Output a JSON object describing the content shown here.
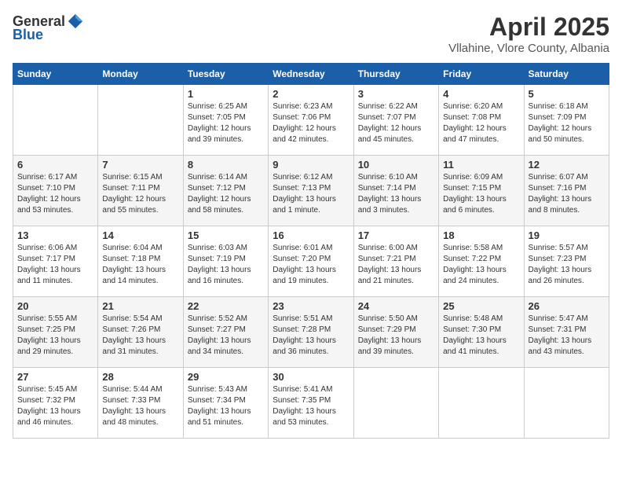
{
  "header": {
    "logo_general": "General",
    "logo_blue": "Blue",
    "month_title": "April 2025",
    "subtitle": "Vllahine, Vlore County, Albania"
  },
  "days_of_week": [
    "Sunday",
    "Monday",
    "Tuesday",
    "Wednesday",
    "Thursday",
    "Friday",
    "Saturday"
  ],
  "weeks": [
    [
      {
        "day": "",
        "sunrise": "",
        "sunset": "",
        "daylight": ""
      },
      {
        "day": "",
        "sunrise": "",
        "sunset": "",
        "daylight": ""
      },
      {
        "day": "1",
        "sunrise": "Sunrise: 6:25 AM",
        "sunset": "Sunset: 7:05 PM",
        "daylight": "Daylight: 12 hours and 39 minutes."
      },
      {
        "day": "2",
        "sunrise": "Sunrise: 6:23 AM",
        "sunset": "Sunset: 7:06 PM",
        "daylight": "Daylight: 12 hours and 42 minutes."
      },
      {
        "day": "3",
        "sunrise": "Sunrise: 6:22 AM",
        "sunset": "Sunset: 7:07 PM",
        "daylight": "Daylight: 12 hours and 45 minutes."
      },
      {
        "day": "4",
        "sunrise": "Sunrise: 6:20 AM",
        "sunset": "Sunset: 7:08 PM",
        "daylight": "Daylight: 12 hours and 47 minutes."
      },
      {
        "day": "5",
        "sunrise": "Sunrise: 6:18 AM",
        "sunset": "Sunset: 7:09 PM",
        "daylight": "Daylight: 12 hours and 50 minutes."
      }
    ],
    [
      {
        "day": "6",
        "sunrise": "Sunrise: 6:17 AM",
        "sunset": "Sunset: 7:10 PM",
        "daylight": "Daylight: 12 hours and 53 minutes."
      },
      {
        "day": "7",
        "sunrise": "Sunrise: 6:15 AM",
        "sunset": "Sunset: 7:11 PM",
        "daylight": "Daylight: 12 hours and 55 minutes."
      },
      {
        "day": "8",
        "sunrise": "Sunrise: 6:14 AM",
        "sunset": "Sunset: 7:12 PM",
        "daylight": "Daylight: 12 hours and 58 minutes."
      },
      {
        "day": "9",
        "sunrise": "Sunrise: 6:12 AM",
        "sunset": "Sunset: 7:13 PM",
        "daylight": "Daylight: 13 hours and 1 minute."
      },
      {
        "day": "10",
        "sunrise": "Sunrise: 6:10 AM",
        "sunset": "Sunset: 7:14 PM",
        "daylight": "Daylight: 13 hours and 3 minutes."
      },
      {
        "day": "11",
        "sunrise": "Sunrise: 6:09 AM",
        "sunset": "Sunset: 7:15 PM",
        "daylight": "Daylight: 13 hours and 6 minutes."
      },
      {
        "day": "12",
        "sunrise": "Sunrise: 6:07 AM",
        "sunset": "Sunset: 7:16 PM",
        "daylight": "Daylight: 13 hours and 8 minutes."
      }
    ],
    [
      {
        "day": "13",
        "sunrise": "Sunrise: 6:06 AM",
        "sunset": "Sunset: 7:17 PM",
        "daylight": "Daylight: 13 hours and 11 minutes."
      },
      {
        "day": "14",
        "sunrise": "Sunrise: 6:04 AM",
        "sunset": "Sunset: 7:18 PM",
        "daylight": "Daylight: 13 hours and 14 minutes."
      },
      {
        "day": "15",
        "sunrise": "Sunrise: 6:03 AM",
        "sunset": "Sunset: 7:19 PM",
        "daylight": "Daylight: 13 hours and 16 minutes."
      },
      {
        "day": "16",
        "sunrise": "Sunrise: 6:01 AM",
        "sunset": "Sunset: 7:20 PM",
        "daylight": "Daylight: 13 hours and 19 minutes."
      },
      {
        "day": "17",
        "sunrise": "Sunrise: 6:00 AM",
        "sunset": "Sunset: 7:21 PM",
        "daylight": "Daylight: 13 hours and 21 minutes."
      },
      {
        "day": "18",
        "sunrise": "Sunrise: 5:58 AM",
        "sunset": "Sunset: 7:22 PM",
        "daylight": "Daylight: 13 hours and 24 minutes."
      },
      {
        "day": "19",
        "sunrise": "Sunrise: 5:57 AM",
        "sunset": "Sunset: 7:23 PM",
        "daylight": "Daylight: 13 hours and 26 minutes."
      }
    ],
    [
      {
        "day": "20",
        "sunrise": "Sunrise: 5:55 AM",
        "sunset": "Sunset: 7:25 PM",
        "daylight": "Daylight: 13 hours and 29 minutes."
      },
      {
        "day": "21",
        "sunrise": "Sunrise: 5:54 AM",
        "sunset": "Sunset: 7:26 PM",
        "daylight": "Daylight: 13 hours and 31 minutes."
      },
      {
        "day": "22",
        "sunrise": "Sunrise: 5:52 AM",
        "sunset": "Sunset: 7:27 PM",
        "daylight": "Daylight: 13 hours and 34 minutes."
      },
      {
        "day": "23",
        "sunrise": "Sunrise: 5:51 AM",
        "sunset": "Sunset: 7:28 PM",
        "daylight": "Daylight: 13 hours and 36 minutes."
      },
      {
        "day": "24",
        "sunrise": "Sunrise: 5:50 AM",
        "sunset": "Sunset: 7:29 PM",
        "daylight": "Daylight: 13 hours and 39 minutes."
      },
      {
        "day": "25",
        "sunrise": "Sunrise: 5:48 AM",
        "sunset": "Sunset: 7:30 PM",
        "daylight": "Daylight: 13 hours and 41 minutes."
      },
      {
        "day": "26",
        "sunrise": "Sunrise: 5:47 AM",
        "sunset": "Sunset: 7:31 PM",
        "daylight": "Daylight: 13 hours and 43 minutes."
      }
    ],
    [
      {
        "day": "27",
        "sunrise": "Sunrise: 5:45 AM",
        "sunset": "Sunset: 7:32 PM",
        "daylight": "Daylight: 13 hours and 46 minutes."
      },
      {
        "day": "28",
        "sunrise": "Sunrise: 5:44 AM",
        "sunset": "Sunset: 7:33 PM",
        "daylight": "Daylight: 13 hours and 48 minutes."
      },
      {
        "day": "29",
        "sunrise": "Sunrise: 5:43 AM",
        "sunset": "Sunset: 7:34 PM",
        "daylight": "Daylight: 13 hours and 51 minutes."
      },
      {
        "day": "30",
        "sunrise": "Sunrise: 5:41 AM",
        "sunset": "Sunset: 7:35 PM",
        "daylight": "Daylight: 13 hours and 53 minutes."
      },
      {
        "day": "",
        "sunrise": "",
        "sunset": "",
        "daylight": ""
      },
      {
        "day": "",
        "sunrise": "",
        "sunset": "",
        "daylight": ""
      },
      {
        "day": "",
        "sunrise": "",
        "sunset": "",
        "daylight": ""
      }
    ]
  ]
}
